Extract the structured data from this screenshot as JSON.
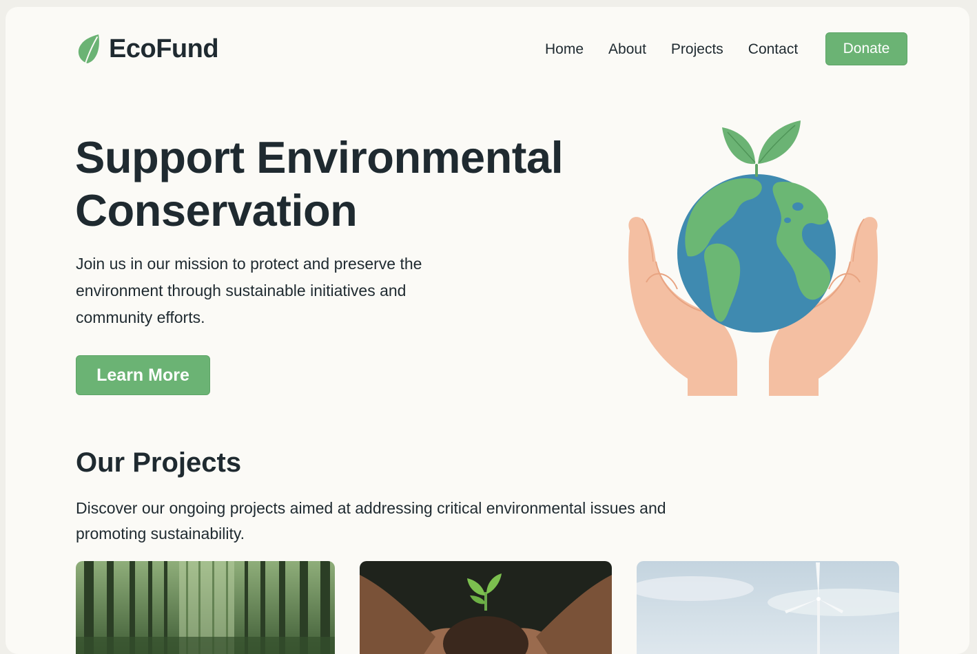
{
  "brand": {
    "name": "EcoFund",
    "icon": "leaf-icon",
    "accent_color": "#6bb374",
    "text_color": "#1f2a30"
  },
  "nav": {
    "items": [
      {
        "label": "Home"
      },
      {
        "label": "About"
      },
      {
        "label": "Projects"
      },
      {
        "label": "Contact"
      }
    ],
    "donate_label": "Donate"
  },
  "hero": {
    "title": "Support Environmental Conservation",
    "description": "Join us in our mission to protect and preserve the environment through sustainable initiatives and community efforts.",
    "cta_label": "Learn More",
    "illustration": "hands-holding-earth-with-sprout"
  },
  "projects": {
    "title": "Our Projects",
    "description": "Discover our ongoing projects aimed at addressing critical environmental issues and promoting sustainability.",
    "cards": [
      {
        "image": "forest-photo"
      },
      {
        "image": "sapling-in-hands-photo"
      },
      {
        "image": "wind-turbine-photo"
      }
    ]
  }
}
